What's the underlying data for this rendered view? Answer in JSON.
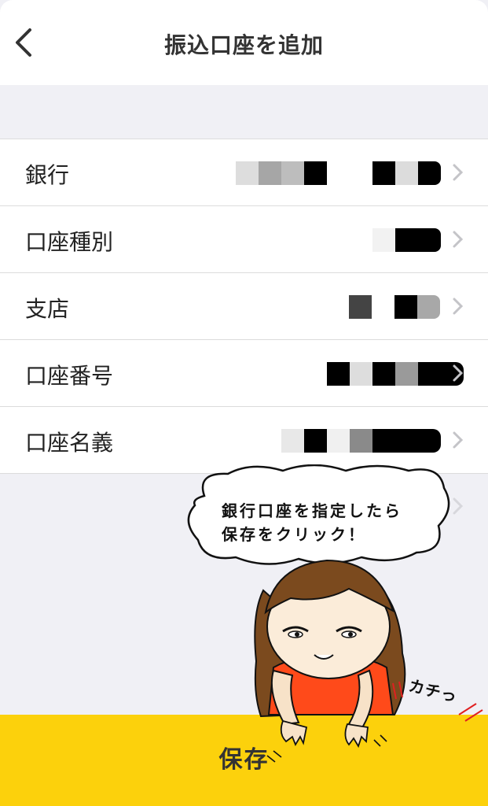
{
  "header": {
    "title": "振込口座を追加",
    "back_icon": "chevron-left-icon"
  },
  "rows": [
    {
      "label": "銀行"
    },
    {
      "label": "口座種別"
    },
    {
      "label": "支店"
    },
    {
      "label": "口座番号"
    },
    {
      "label": "口座名義"
    }
  ],
  "footer": {
    "save_label": "保存",
    "accent_color": "#fcd10c"
  },
  "illustration": {
    "speech_lines": [
      "銀行口座を指定したら",
      "保存をクリック！"
    ],
    "sound_effect": "カチっ"
  }
}
